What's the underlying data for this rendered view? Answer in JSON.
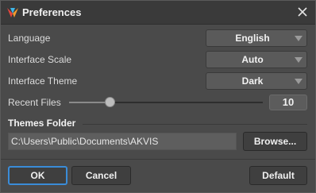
{
  "window": {
    "title": "Preferences",
    "icons": {
      "app": "akvis-logo-icon",
      "close": "close-icon"
    },
    "colors": {
      "accent": "#3a8cd8",
      "background": "#4a4a4a",
      "titlebar": "#3a3a3a"
    }
  },
  "settings": {
    "language": {
      "label": "Language",
      "value": "English"
    },
    "interface_scale": {
      "label": "Interface Scale",
      "value": "Auto"
    },
    "interface_theme": {
      "label": "Interface Theme",
      "value": "Dark"
    },
    "recent_files": {
      "label": "Recent Files",
      "value": "10",
      "slider_fraction": 0.21
    }
  },
  "themes_folder": {
    "title": "Themes Folder",
    "path": "C:\\Users\\Public\\Documents\\AKVIS",
    "browse_label": "Browse..."
  },
  "buttons": {
    "ok": "OK",
    "cancel": "Cancel",
    "default": "Default"
  }
}
